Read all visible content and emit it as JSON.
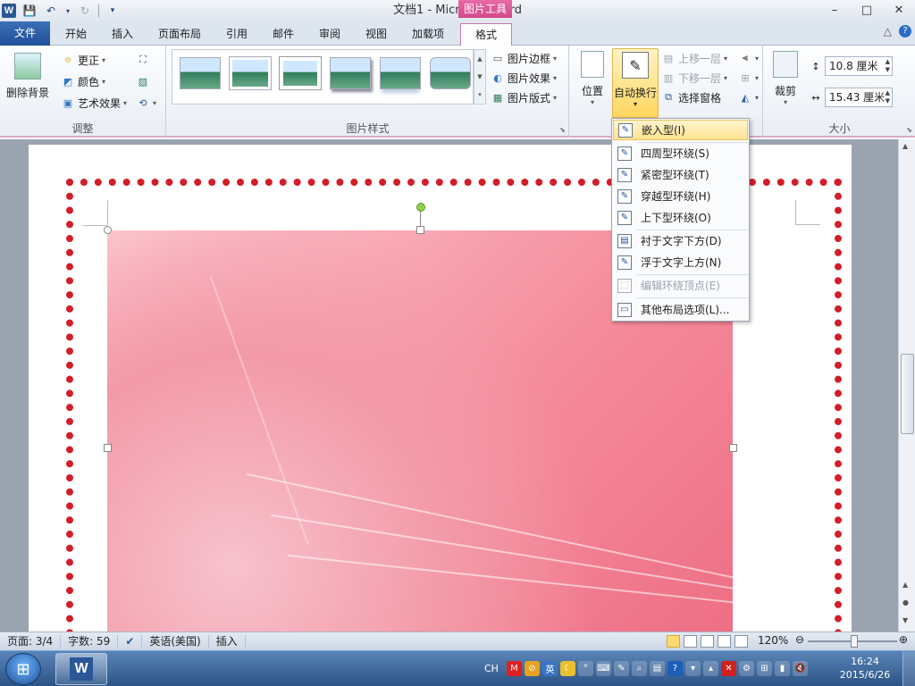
{
  "window": {
    "title": "文档1  -  Microsoft Word",
    "context_tab_group": "图片工具"
  },
  "qat": {
    "app_icon": "W",
    "save": "save-icon",
    "undo": "undo-icon",
    "redo": "redo-icon",
    "customize": "customize-qat-icon"
  },
  "window_controls": {
    "minimize": "–",
    "maximize": "□",
    "close": "✕"
  },
  "tabs": [
    "文件",
    "开始",
    "插入",
    "页面布局",
    "引用",
    "邮件",
    "审阅",
    "视图",
    "加载项",
    "格式"
  ],
  "active_tab": "格式",
  "tabrow_right": {
    "minimize_ribbon": "△",
    "help": "?"
  },
  "ribbon": {
    "adjust": {
      "label": "调整",
      "remove_bg": "删除背景",
      "corrections": "更正",
      "color": "颜色",
      "artistic": "艺术效果"
    },
    "picture_styles": {
      "label": "图片样式",
      "border": "图片边框",
      "effects": "图片效果",
      "layout": "图片版式"
    },
    "arrange": {
      "position": "位置",
      "wrap_text": "自动换行",
      "bring_forward": "上移一层",
      "send_backward": "下移一层",
      "selection_pane": "选择窗格"
    },
    "size": {
      "label": "大小",
      "crop": "裁剪",
      "height": "10.8 厘米",
      "width": "15.43 厘米"
    }
  },
  "wrap_menu": {
    "items": [
      {
        "label": "嵌入型(I)",
        "state": "hover"
      },
      {
        "label": "四周型环绕(S)",
        "state": "normal"
      },
      {
        "label": "紧密型环绕(T)",
        "state": "normal"
      },
      {
        "label": "穿越型环绕(H)",
        "state": "normal"
      },
      {
        "label": "上下型环绕(O)",
        "state": "normal"
      },
      {
        "label": "衬于文字下方(D)",
        "state": "normal"
      },
      {
        "label": "浮于文字上方(N)",
        "state": "normal"
      },
      {
        "label": "编辑环绕顶点(E)",
        "state": "disabled"
      },
      {
        "label": "其他布局选项(L)...",
        "state": "normal"
      }
    ]
  },
  "statusbar": {
    "page": "页面: 3/4",
    "words": "字数: 59",
    "language": "英语(美国)",
    "mode": "插入",
    "zoom": "120%",
    "zoom_level_percent": 120
  },
  "taskbar": {
    "ime": "CH",
    "time": "16:24",
    "date": "2015/6/26"
  },
  "colors": {
    "file_tab": "#2b5797",
    "picture_tools": "#d3488a",
    "dot_border": "#d21e2a",
    "hover": "#ffe38f"
  }
}
